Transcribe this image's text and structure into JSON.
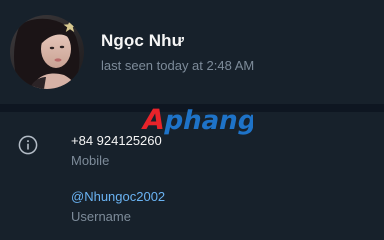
{
  "profile": {
    "name": "Ngọc Như",
    "status": "last seen today at 2:48 AM"
  },
  "info": {
    "phone": "+84 924125260",
    "phone_label": "Mobile",
    "username": "@Nhungoc2002",
    "username_label": "Username"
  },
  "watermark": {
    "text": "Aphang"
  },
  "colors": {
    "background": "#17212b",
    "divider": "#0e1621",
    "link": "#6ab3f3",
    "secondary_text": "#7d8b99"
  }
}
